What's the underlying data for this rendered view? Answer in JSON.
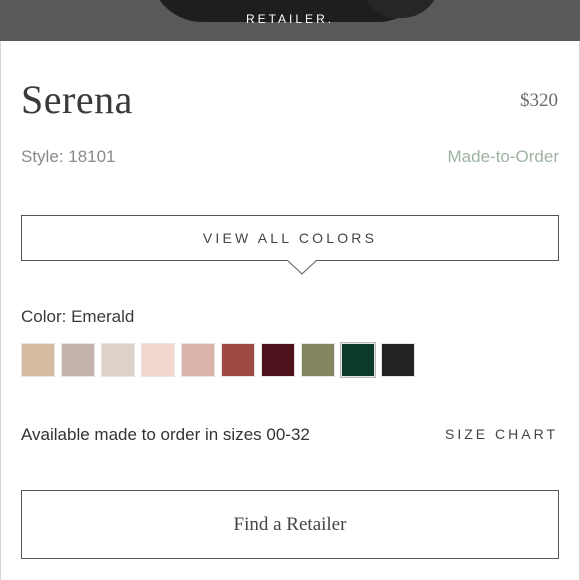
{
  "banner": {
    "text": "RETAILER."
  },
  "product": {
    "name": "Serena",
    "price": "$320",
    "style": "Style: 18101",
    "availability_tag": "Made-to-Order"
  },
  "buttons": {
    "view_all_colors": "VIEW ALL COLORS",
    "find_retailer": "Find a Retailer",
    "size_chart": "SIZE CHART"
  },
  "color": {
    "label": "Color: Emerald",
    "selected_index": 8,
    "swatches": [
      {
        "hex": "#d4bb9f"
      },
      {
        "hex": "#c2b3ac"
      },
      {
        "hex": "#dcd2ca"
      },
      {
        "hex": "#f1d7ce"
      },
      {
        "hex": "#dcb3ab"
      },
      {
        "hex": "#9d4a42"
      },
      {
        "hex": "#4d111b"
      },
      {
        "hex": "#84865f"
      },
      {
        "hex": "#0b3a2b"
      },
      {
        "hex": "#232323"
      }
    ]
  },
  "sizes": {
    "text": "Available made to order in sizes 00-32"
  },
  "colors": {
    "accent_green": "#9fb3a3",
    "border": "#555555"
  }
}
